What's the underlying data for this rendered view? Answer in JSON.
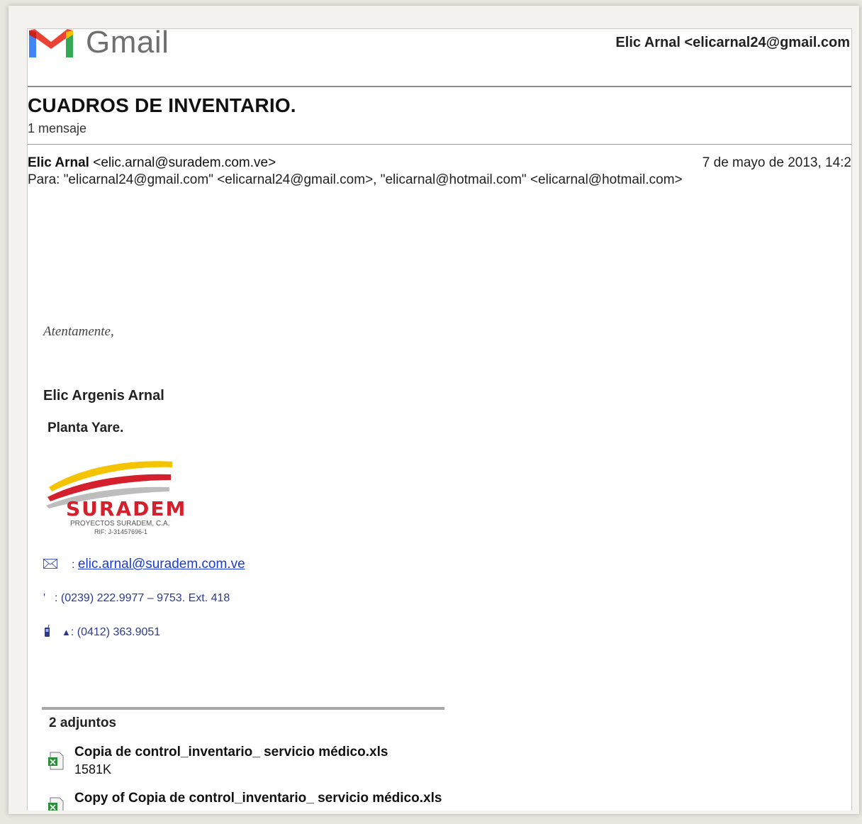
{
  "header": {
    "brand": "Gmail",
    "account": "Elic Arnal <elicarnal24@gmail.com"
  },
  "thread": {
    "subject": "CUADROS DE INVENTARIO.",
    "message_count": "1 mensaje"
  },
  "message": {
    "sender_name": "Elic Arnal",
    "sender_email": "<elic.arnal@suradem.com.ve>",
    "date": "7 de mayo de 2013, 14:2",
    "to": "Para: \"elicarnal24@gmail.com\" <elicarnal24@gmail.com>, \"elicarnal@hotmail.com\" <elicarnal@hotmail.com>"
  },
  "signature": {
    "closing": "Atentamente,",
    "name": "Elic Argenis Arnal",
    "plant": "Planta Yare.",
    "logo_text": "SURADEM",
    "logo_subtext": "PROYECTOS SURADEM, C.A.",
    "logo_rif": "RIF: J-31457696-1",
    "email_prefix": ":",
    "email": "elic.arnal@suradem.com.ve",
    "phone_office": ": (0239) 222.9977 – 9753. Ext. 418",
    "phone_mobile_prefix": "▲",
    "phone_mobile": ": (0412) 363.9051"
  },
  "attachments": {
    "title": "2 adjuntos",
    "items": [
      {
        "name": "Copia de control_inventario_ servicio médico.xls",
        "size": "1581K"
      },
      {
        "name": "Copy of Copia de control_inventario_ servicio médico.xls",
        "size": ""
      }
    ]
  },
  "colors": {
    "gmail_red": "#ea4335",
    "link_blue": "#1a3bd1",
    "contact_blue": "#2b3a8f",
    "suradem_red": "#d4202c",
    "suradem_yellow": "#f5c400"
  },
  "icons": [
    "gmail-logo-icon",
    "envelope-icon",
    "phone-icon",
    "mobile-phone-icon",
    "excel-file-icon"
  ]
}
